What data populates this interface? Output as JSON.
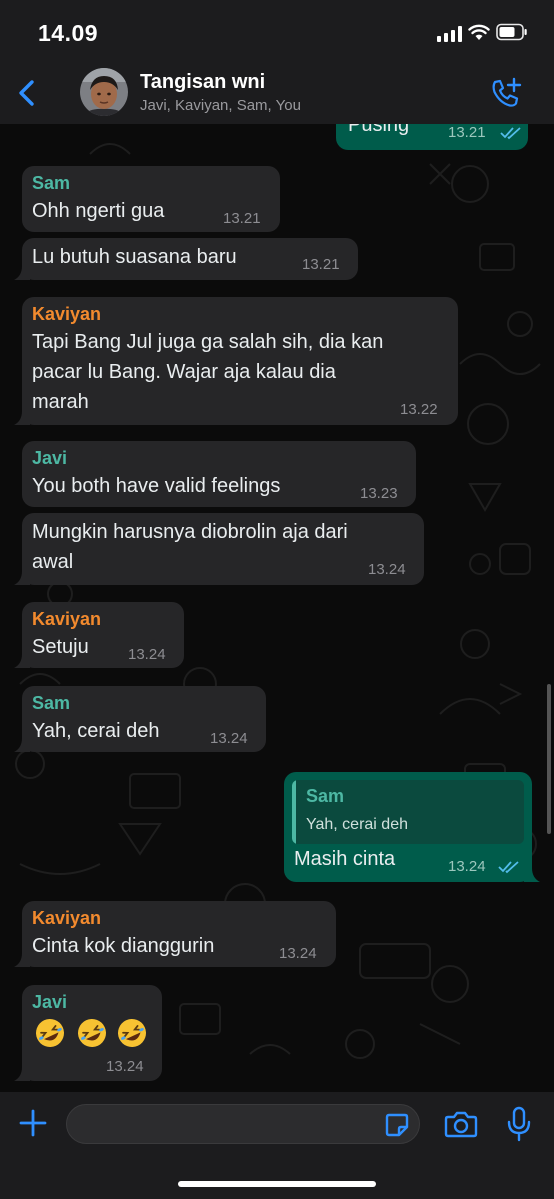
{
  "status_bar": {
    "time": "14.09"
  },
  "header": {
    "title": "Tangisan wni",
    "subtitle": "Javi, Kaviyan, Sam, You",
    "back_icon": "chevron-left-icon",
    "call_icon": "add-call-icon"
  },
  "colors": {
    "accent": "#2f8fff",
    "incoming_bubble": "#262628",
    "outgoing_bubble": "#005c4b",
    "sender_sam": "#4db8a4",
    "sender_kaviyan": "#f28a2e",
    "sender_javi": "#4db8a4",
    "read_ticks": "#53bdeb"
  },
  "messages": [
    {
      "direction": "out",
      "text": "Pusing",
      "time": "13.21",
      "read": true
    },
    {
      "direction": "in",
      "sender": "Sam",
      "text": "Ohh ngerti gua",
      "time": "13.21"
    },
    {
      "direction": "in",
      "text": "Lu butuh suasana baru",
      "time": "13.21"
    },
    {
      "direction": "in",
      "sender": "Kaviyan",
      "lines": [
        "Tapi Bang Jul juga ga salah sih, dia kan",
        "pacar lu Bang. Wajar aja kalau dia",
        "marah"
      ],
      "time": "13.22"
    },
    {
      "direction": "in",
      "sender": "Javi",
      "text": "You both have valid feelings",
      "time": "13.23"
    },
    {
      "direction": "in",
      "lines": [
        "Mungkin harusnya diobrolin aja dari",
        "awal"
      ],
      "time": "13.24"
    },
    {
      "direction": "in",
      "sender": "Kaviyan",
      "text": "Setuju",
      "time": "13.24"
    },
    {
      "direction": "in",
      "sender": "Sam",
      "text": "Yah, cerai deh",
      "time": "13.24"
    },
    {
      "direction": "out",
      "quote": {
        "sender": "Sam",
        "text": "Yah, cerai deh"
      },
      "text": "Masih cinta",
      "time": "13.24",
      "read": true
    },
    {
      "direction": "in",
      "sender": "Kaviyan",
      "text": "Cinta kok dianggurin",
      "time": "13.24"
    },
    {
      "direction": "in",
      "sender": "Javi",
      "emojis": [
        "rolling-on-floor-laughing-emoji",
        "rolling-on-floor-laughing-emoji",
        "rolling-on-floor-laughing-emoji"
      ],
      "time": "13.24"
    }
  ],
  "input_bar": {
    "placeholder": "",
    "icons": [
      "plus-icon",
      "sticker-icon",
      "camera-icon",
      "microphone-icon"
    ]
  }
}
